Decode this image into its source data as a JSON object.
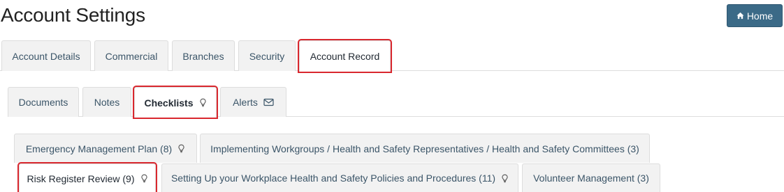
{
  "header": {
    "title": "Account Settings",
    "home_label": "Home"
  },
  "main_tabs": [
    {
      "label": "Account Details"
    },
    {
      "label": "Commercial"
    },
    {
      "label": "Branches"
    },
    {
      "label": "Security"
    },
    {
      "label": "Account Record",
      "active": true,
      "highlighted": true
    }
  ],
  "record_tabs": [
    {
      "label": "Documents"
    },
    {
      "label": "Notes"
    },
    {
      "label": "Checklists",
      "icon": "lightbulb-icon",
      "active": true,
      "highlighted": true
    },
    {
      "label": "Alerts",
      "icon": "envelope-icon"
    }
  ],
  "checklist_tabs": [
    {
      "label": "Emergency Management Plan (8)",
      "icon": "lightbulb-icon"
    },
    {
      "label": "Implementing Workgroups / Health and Safety Representatives / Health and Safety Committees (3)"
    },
    {
      "label": "Risk Register Review (9)",
      "icon": "lightbulb-icon",
      "active": true,
      "highlighted": true
    },
    {
      "label": "Setting Up your Workplace Health and Safety Policies and Procedures (11)",
      "icon": "lightbulb-icon"
    },
    {
      "label": "Volunteer Management (3)"
    }
  ],
  "colors": {
    "highlight": "#d9272e",
    "home_button": "#3b6a87",
    "tab_text": "#3b5568"
  }
}
